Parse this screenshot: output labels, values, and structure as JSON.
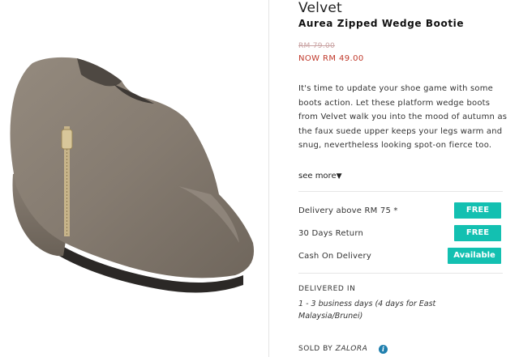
{
  "product": {
    "brand": "Velvet",
    "name": "Aurea Zipped Wedge Bootie",
    "old_price": "RM 79.00",
    "new_price": "NOW RM 49.00",
    "image_alt": "shoe-product-image",
    "description": "It's time to update your shoe game with some boots action. Let these platform wedge boots from Velvet walk you into the mood of autumn as the faux suede upper keeps your legs warm and snug, nevertheless looking spot-on fierce too.",
    "see_more": "see more",
    "see_more_icon": "triangle-down-icon"
  },
  "services": [
    {
      "label": "Delivery above RM 75 *",
      "badge": "FREE"
    },
    {
      "label": "30 Days Return",
      "badge": "FREE"
    },
    {
      "label": "Cash On Delivery",
      "badge": "Available"
    }
  ],
  "delivery": {
    "heading": "DELIVERED IN",
    "detail": "1 - 3 business days (4 days for East Malaysia/Brunei)"
  },
  "seller": {
    "prefix": "SOLD BY",
    "name": "ZALORA",
    "icon": "info-icon"
  },
  "colors": {
    "badge": "#13c0b1",
    "sale_price": "#c0392b",
    "info_icon": "#1f7fae"
  }
}
